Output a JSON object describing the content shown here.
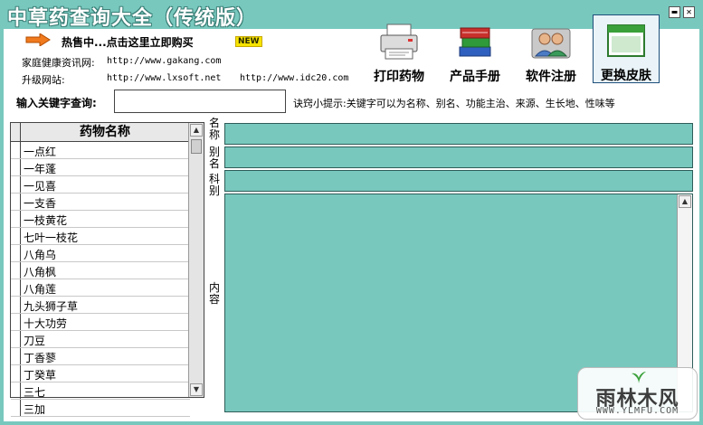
{
  "window": {
    "title": "中草药查询大全（传统版）",
    "minimize_glyph": "▬",
    "close_glyph": "✕"
  },
  "promo": {
    "text": "热售中...点击这里立即购买",
    "badge": "NEW"
  },
  "links": {
    "health_label": "家庭健康资讯网:",
    "health_url": "http://www.gakang.com",
    "upgrade_label": "升级网站:",
    "upgrade_url_1": "http://www.lxsoft.net",
    "upgrade_url_2": "http://www.idc20.com"
  },
  "toolbar": [
    {
      "id": "print",
      "label": "打印药物",
      "icon": "printer-icon"
    },
    {
      "id": "manual",
      "label": "产品手册",
      "icon": "books-icon"
    },
    {
      "id": "register",
      "label": "软件注册",
      "icon": "users-icon"
    },
    {
      "id": "skin",
      "label": "更换皮肤",
      "icon": "window-icon"
    }
  ],
  "search": {
    "label": "输入关键字查询:",
    "value": "",
    "tip": "诀窍小提示:关键字可以为名称、别名、功能主治、来源、生长地、性味等"
  },
  "list": {
    "header": "药物名称",
    "items": [
      "一点红",
      "一年蓬",
      "一见喜",
      "一支香",
      "一枝黄花",
      "七叶一枝花",
      "八角乌",
      "八角枫",
      "八角莲",
      "九头狮子草",
      "十大功劳",
      "刀豆",
      "丁香蓼",
      "丁癸草",
      "三七",
      "三加"
    ]
  },
  "detail": {
    "name_label": "名称",
    "alias_label": "别名",
    "family_label": "科别",
    "content_label": "内容"
  },
  "watermark": {
    "brand": "雨林木风",
    "url": "WWW.YLMFU.COM"
  },
  "colors": {
    "theme_teal": "#78c8be",
    "title_text": "#ffffff",
    "arrow": "#f07a1e"
  }
}
